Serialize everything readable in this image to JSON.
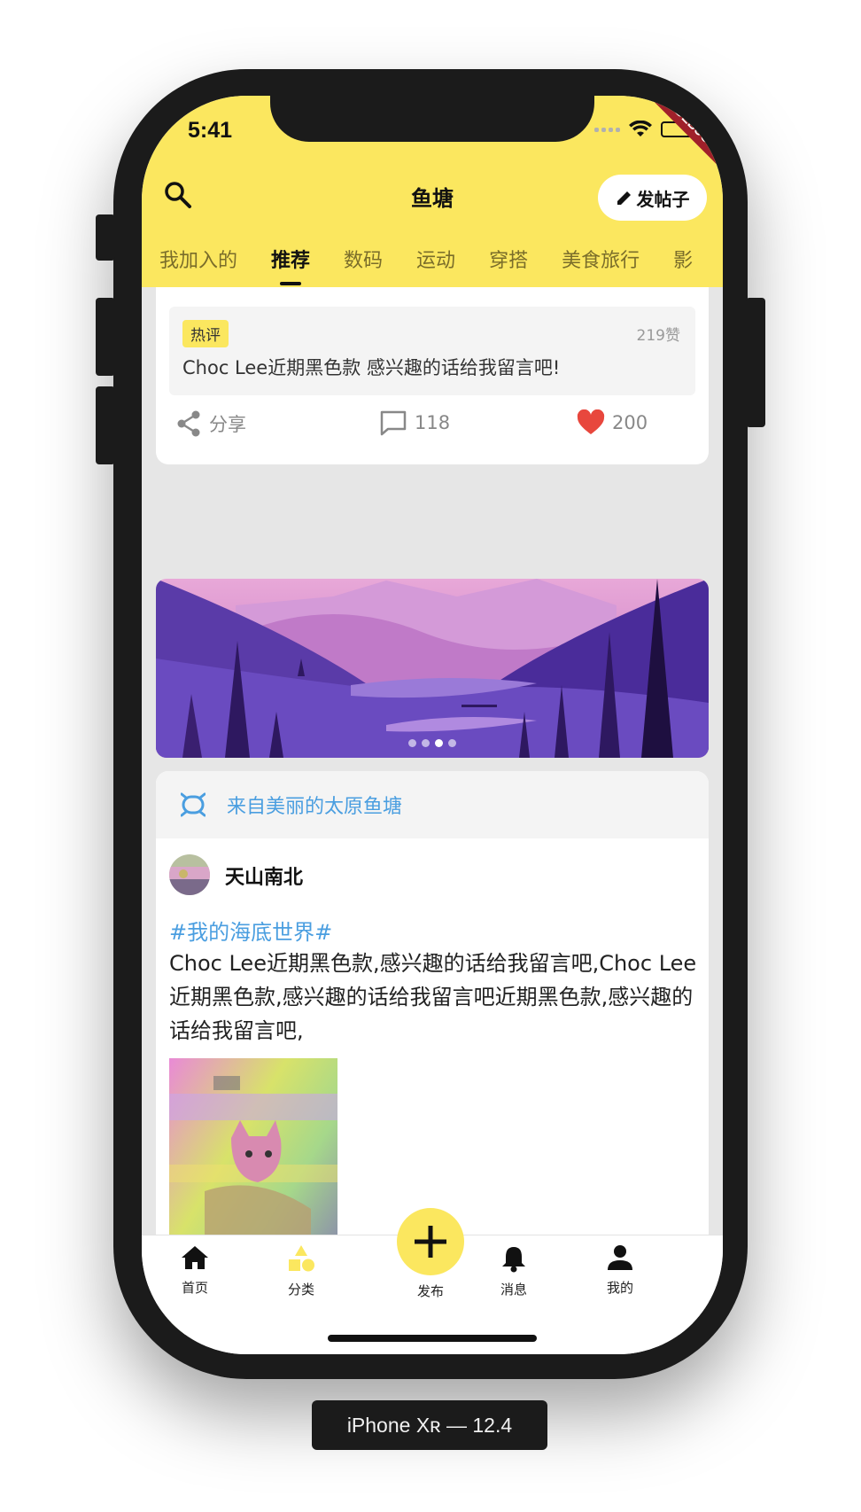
{
  "status_bar": {
    "time": "5:41",
    "debug_label": "DEBUG"
  },
  "header": {
    "title": "鱼塘",
    "post_button_label": "发帖子"
  },
  "tabs": [
    {
      "label": "我加入的",
      "active": false
    },
    {
      "label": "推荐",
      "active": true
    },
    {
      "label": "数码",
      "active": false
    },
    {
      "label": "运动",
      "active": false
    },
    {
      "label": "穿搭",
      "active": false
    },
    {
      "label": "美食旅行",
      "active": false
    },
    {
      "label": "影",
      "active": false
    }
  ],
  "card1": {
    "hot_badge": "热评",
    "likes_count": "219赞",
    "comment_text": "Choc Lee近期黑色款 感兴趣的话给我留言吧!",
    "share_label": "分享",
    "comment_count": "118",
    "like_count": "200"
  },
  "banner": {
    "dots": 4,
    "active_dot": 2
  },
  "card2": {
    "pond_label": "来自美丽的太原鱼塘",
    "username": "天山南北",
    "topic": "#我的海底世界#",
    "body": "Choc Lee近期黑色款,感兴趣的话给我留言吧,Choc Lee近期黑色款,感兴趣的话给我留言吧近期黑色款,感兴趣的话给我留言吧,"
  },
  "tabbar": {
    "items": [
      {
        "label": "首页",
        "icon": "home-icon"
      },
      {
        "label": "分类",
        "icon": "category-icon"
      },
      {
        "label": "发布",
        "icon": "plus-icon"
      },
      {
        "label": "消息",
        "icon": "bell-icon"
      },
      {
        "label": "我的",
        "icon": "person-icon"
      }
    ]
  },
  "colors": {
    "accent": "#fbe75f",
    "link": "#4a9ee0",
    "like": "#e8473d"
  },
  "device_label": "iPhone Xʀ — 12.4"
}
